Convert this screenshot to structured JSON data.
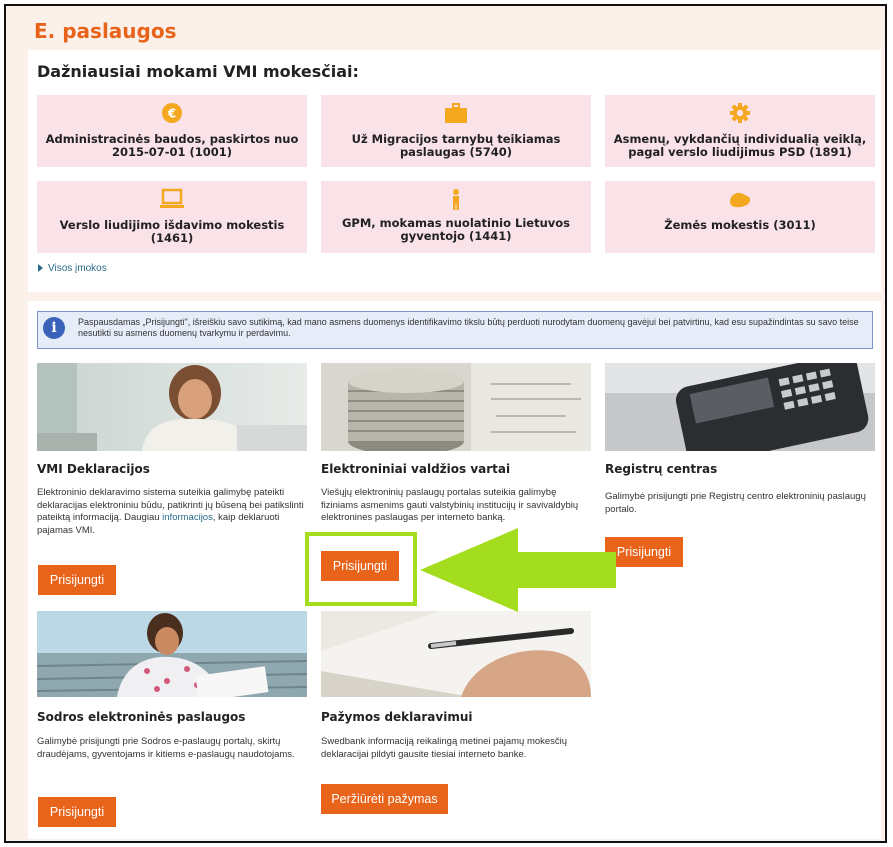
{
  "title": "E. paslaugos",
  "top_section": {
    "subtitle": "Dažniausiai mokami VMI mokesčiai:",
    "tiles": [
      {
        "icon": "euro-coin-icon",
        "label_lines": [
          "Administracinės baudos, paskirtos nuo",
          "2015-07-01 (1001)"
        ]
      },
      {
        "icon": "briefcase-icon",
        "label_lines": [
          "Už Migracijos tarnybų teikiamas",
          "paslaugas (5740)"
        ]
      },
      {
        "icon": "gear-icon",
        "label_lines": [
          "Asmenų, vykdančių individualią veiklą,",
          "pagal verslo liudijimus PSD (1891)"
        ]
      },
      {
        "icon": "laptop-icon",
        "label_lines": [
          "Verslo liudijimo išdavimo mokestis",
          "(1461)"
        ]
      },
      {
        "icon": "person-icon",
        "label_lines": [
          "GPM, mokamas nuolatinio Lietuvos",
          "gyventojo (1441)"
        ]
      },
      {
        "icon": "land-icon",
        "label_lines": [
          "Žemės mokestis (3011)"
        ]
      }
    ],
    "all_payments_link": "Visos įmokos"
  },
  "info_notice": {
    "icon": "info-icon",
    "text": "Paspausdamas „Prisijungti\", išreiškiu savo sutikimą, kad mano asmens duomenys identifikavimo tikslu būtų perduoti nurodytam duomenų gavėjui bei patvirtinu, kad esu supažindintas su savo teise nesutikti su asmens duomenų tvarkymu ir perdavimu."
  },
  "services": [
    {
      "title": "VMI Deklaracijos",
      "image": "man-with-laptop-photo",
      "desc_before_link": "Elektroninio deklaravimo sistema suteikia galimybę pateikti deklaracijas elektroniniu būdu, patikrinti jų būseną bei patikslinti pateiktą informaciją. Daugiau ",
      "desc_link": "informacijos",
      "desc_after_link": ", kaip deklaruoti pajamas VMI.",
      "button_label": "Prisijungti"
    },
    {
      "title": "Elektroniniai valdžios vartai",
      "image": "coins-stack-photo",
      "description": "Viešųjų elektroninių paslaugų portalas suteikia galimybę fiziniams asmenims gauti valstybinių institucijų ir savivaldybių elektronines paslaugas per interneto banką.",
      "button_label": "Prisijungti"
    },
    {
      "title": "Registrų centras",
      "image": "mobile-phone-photo",
      "description": "Galimybė prisijungti prie Registrų centro elektroninių paslaugų portalo.",
      "button_label": "Prisijungti"
    },
    {
      "title": "Sodros elektroninės paslaugos",
      "image": "woman-reading-photo",
      "description": "Galimybė prisijungti prie Sodros e-paslaugų portalų, skirtų draudėjams, gyventojams ir kitiems e-paslaugų naudotojams.",
      "button_label": "Prisijungti"
    },
    {
      "title": "Pažymos deklaravimui",
      "image": "hand-with-pen-photo",
      "description": "Swedbank informaciją reikalingą metinei pajamų mokesčių deklaracijai pildyti gausite tiesiai interneto banke.",
      "button_label": "Peržiūrėti pažymas"
    }
  ],
  "colors": {
    "accent_orange": "#e8641b",
    "tile_pink": "#f9e2e8",
    "annotation_green": "#a4dd1e",
    "info_blue": "#3a62b8"
  }
}
